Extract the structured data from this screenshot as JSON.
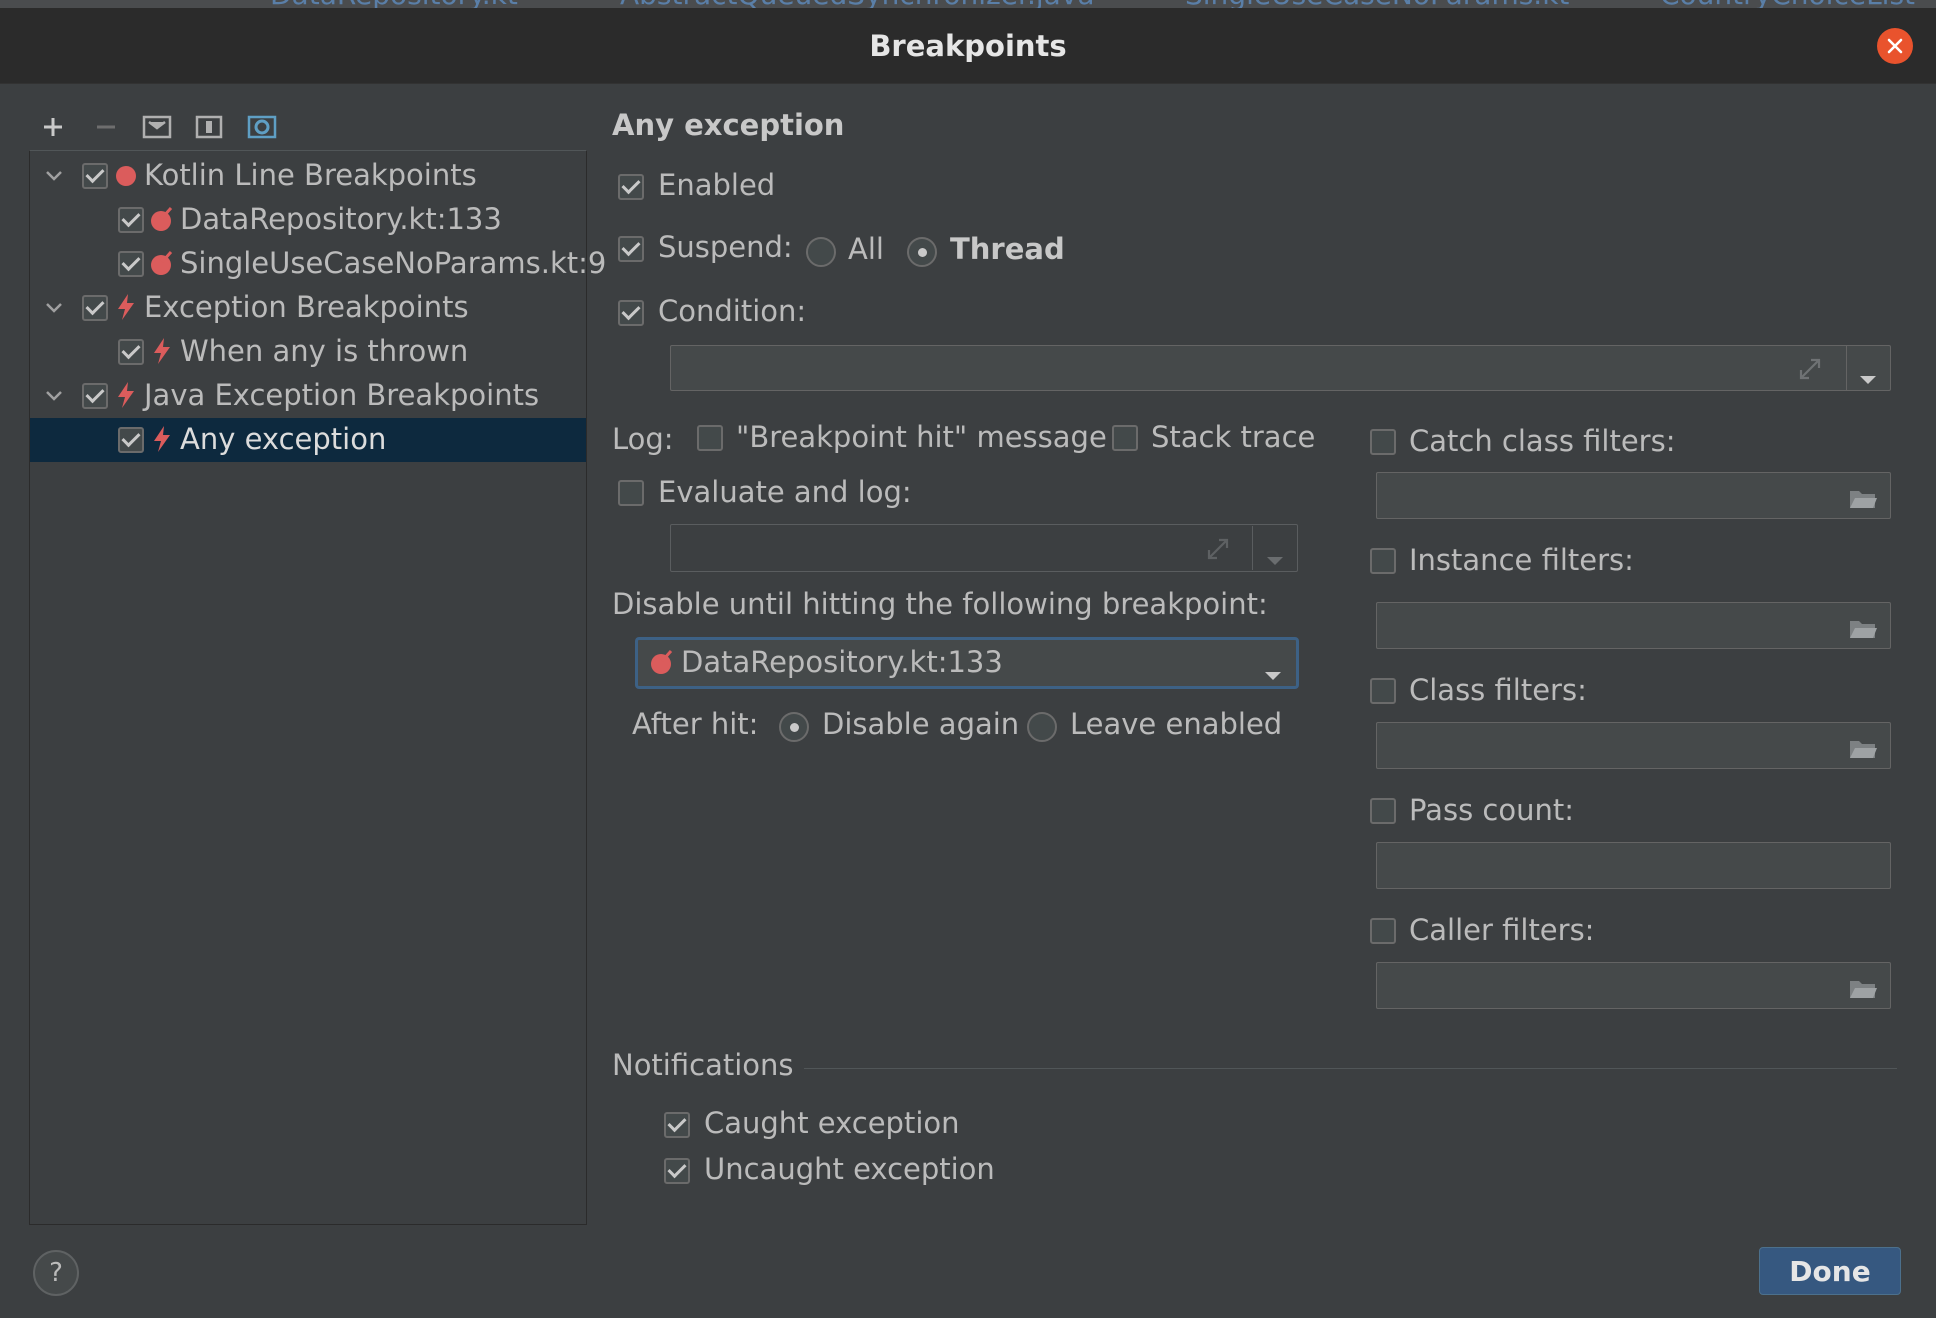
{
  "dialog": {
    "title": "Breakpoints"
  },
  "ide_tabs": [
    "DataRepository.kt",
    "AbstractQueuedSynchronizer.java",
    "SingleUseCaseNoParams.kt",
    "CountryChoiceList"
  ],
  "tree": {
    "items": [
      {
        "label": "Kotlin Line Breakpoints",
        "checked": true,
        "expanded": true,
        "icon": "breakpoint-dot-icon"
      },
      {
        "label": "DataRepository.kt:133",
        "checked": true,
        "icon": "line-breakpoint-icon"
      },
      {
        "label": "SingleUseCaseNoParams.kt:9",
        "checked": true,
        "icon": "line-breakpoint-icon"
      },
      {
        "label": "Exception Breakpoints",
        "checked": true,
        "expanded": true,
        "icon": "lightning-icon"
      },
      {
        "label": "When any is thrown",
        "checked": true,
        "icon": "lightning-icon"
      },
      {
        "label": "Java Exception Breakpoints",
        "checked": true,
        "expanded": true,
        "icon": "lightning-icon"
      },
      {
        "label": "Any exception",
        "checked": true,
        "selected": true,
        "icon": "lightning-icon"
      }
    ]
  },
  "details": {
    "heading": "Any exception",
    "enabled_label": "Enabled",
    "suspend_label": "Suspend:",
    "suspend_all": "All",
    "suspend_thread": "Thread",
    "condition_label": "Condition:",
    "log_label": "Log:",
    "log_message": "\"Breakpoint hit\" message",
    "log_stack": "Stack trace",
    "evaluate_label": "Evaluate and log:",
    "disable_until_label": "Disable until hitting the following breakpoint:",
    "disable_until_value": "DataRepository.kt:133",
    "after_hit_label": "After hit:",
    "after_hit_disable": "Disable again",
    "after_hit_leave": "Leave enabled",
    "catch_filters": "Catch class filters:",
    "instance_filters": "Instance filters:",
    "class_filters": "Class filters:",
    "pass_count": "Pass count:",
    "caller_filters": "Caller filters:",
    "notifications_label": "Notifications",
    "caught_exception": "Caught exception",
    "uncaught_exception": "Uncaught exception"
  },
  "buttons": {
    "done": "Done",
    "help": "?"
  },
  "colors": {
    "accent": "#365880",
    "breakpoint_red": "#db5c5c",
    "selection": "#0d293e",
    "close": "#e9532d"
  }
}
